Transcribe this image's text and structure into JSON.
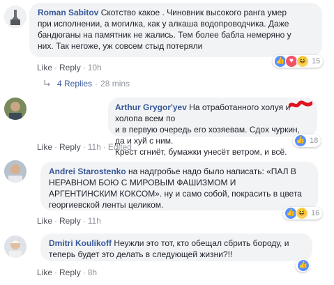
{
  "colors": {
    "link": "#385898",
    "bubble": "#f2f3f5",
    "meta": "#90949c",
    "like": "#5890ff",
    "love": "#f25268",
    "haha": "#fcd15b"
  },
  "comments": [
    {
      "author": "Roman Sabitov",
      "lines": [
        " Скотство какое . Чиновник высокого ранга умер",
        "при исполнении, а могилка, как у алкаша водопроводчика. Даже",
        "бандюганы на памятник не жались. Тем более бабла немеряно у",
        "них. Так негоже, уж совсем стыд потеряли"
      ],
      "reactions": [
        "like-icon",
        "love-icon",
        "haha-icon"
      ],
      "reaction_count": "15",
      "like_label": "Like",
      "reply_label": "Reply",
      "time": "10h",
      "replies": {
        "label": "4 Replies",
        "time": "28 mins"
      }
    },
    {
      "author": "Arthur Grygor'yev",
      "lines": [
        " На отработанного холуя и холопа всем по",
        "и в первую очередь его хозяевам. Сдох чуркин, да и хуй с ним.",
        "Крест сгниёт, бумажки унесёт ветром, и всё."
      ],
      "reactions": [
        "like-icon"
      ],
      "reaction_count": "18",
      "like_label": "Like",
      "reply_label": "Reply",
      "time": "11h",
      "edited": "Edited"
    },
    {
      "author": "Andrei Starostenko",
      "lines": [
        " на надгробье надо было написать: «ПАЛ В",
        "НЕРАВНОМ БОЮ С МИРОВЫМ ФАШИЗМОМ И",
        "АРГЕНТИНСКИМ КОКСОМ». ну и само собой, покрасить в цвета",
        "георгиевской ленты целиком."
      ],
      "reactions": [
        "like-icon",
        "haha-icon"
      ],
      "reaction_count": "16",
      "like_label": "Like",
      "reply_label": "Reply",
      "time": "11h"
    },
    {
      "author": "Dmitri Koulikoff",
      "lines": [
        " Неужли это тот, кто обещал сбрить бороду, и",
        "теперь будет это делать в следующей жизни?!!"
      ],
      "reactions": [
        "like-icon"
      ],
      "reaction_count": "",
      "like_label": "Like",
      "reply_label": "Reply",
      "time": "8h"
    }
  ]
}
